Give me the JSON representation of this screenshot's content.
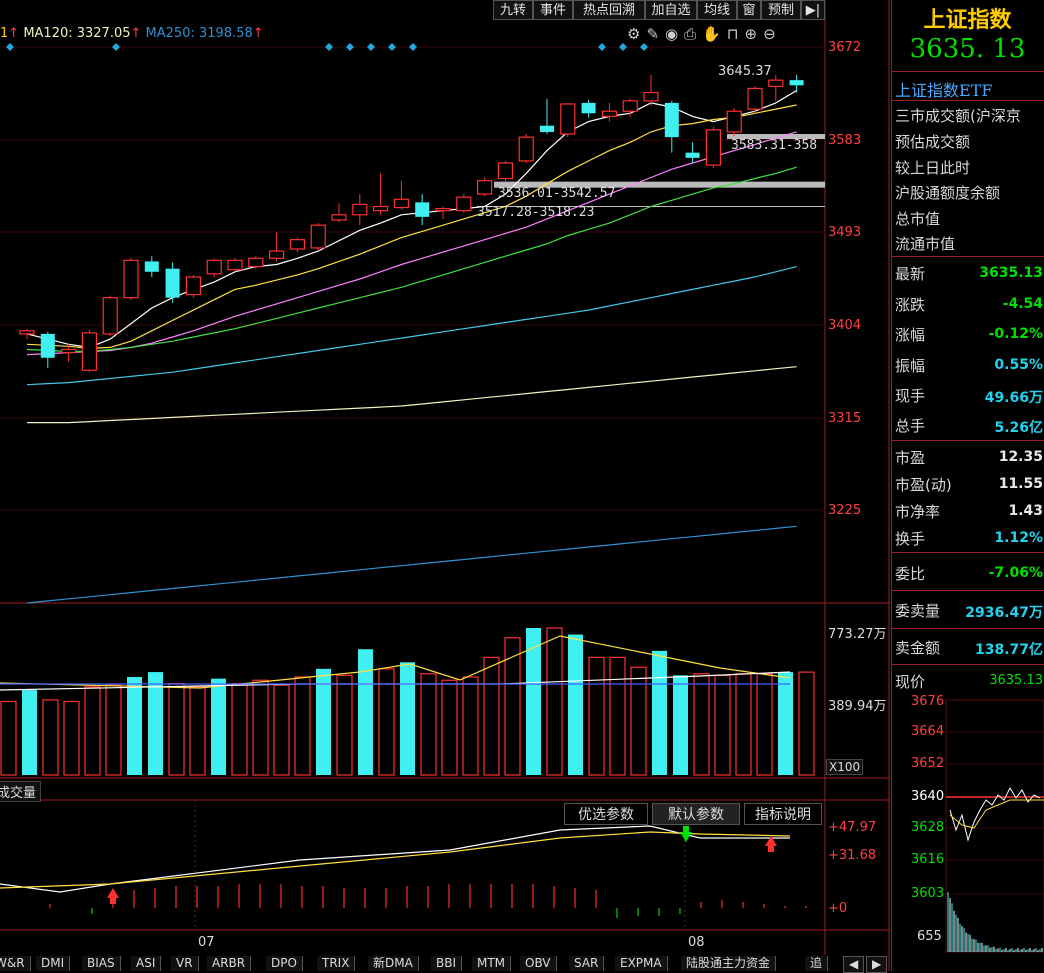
{
  "toolbar": {
    "buttons": [
      "九转",
      "事件",
      "热点回溯",
      "加自选",
      "均线",
      "窗",
      "预制"
    ]
  },
  "ma_legend": {
    "ma120_label": "MA120: 3327.05",
    "ma250_label": "MA250: 3198.58",
    "left_fragment": "1"
  },
  "price_axis": [
    "3672",
    "3583",
    "3493",
    "3404",
    "3315",
    "3225"
  ],
  "annotations": {
    "high": "3645.37",
    "gap1": "3583.31-358",
    "gap2": "3536.01-3542.57",
    "gap3": "3517.28-3518.23"
  },
  "volume_axis": {
    "top": "773.27万",
    "mid": "389.94万",
    "unit": "X100",
    "label": "成交量"
  },
  "macd": {
    "buttons": [
      "优选参数",
      "默认参数",
      "指标说明"
    ],
    "axis": [
      "+47.97",
      "+31.68",
      "+0"
    ]
  },
  "time_axis": [
    "07",
    "08"
  ],
  "indicator_tabs": [
    "W&R",
    "DMI",
    "BIAS",
    "ASI",
    "VR",
    "ARBR",
    "DPO",
    "TRIX",
    "新DMA",
    "BBI",
    "MTM",
    "OBV",
    "SAR",
    "EXPMA",
    "陆股通主力资金",
    "追"
  ],
  "panel": {
    "title": "上证指数",
    "price": "3635. 13",
    "etf": "上证指数ETF",
    "info_rows": [
      "三市成交额(沪深京",
      "预估成交额",
      "较上日此时",
      "沪股通额度余额",
      "总市值",
      "流通市值"
    ],
    "quotes": [
      {
        "label": "最新",
        "value": "3635.13"
      },
      {
        "label": "涨跌",
        "value": "-4.54"
      },
      {
        "label": "涨幅",
        "value": "-0.12%"
      },
      {
        "label": "振幅",
        "value": "0.55%"
      },
      {
        "label": "现手",
        "value": "49.66万"
      },
      {
        "label": "总手",
        "value": "5.26亿"
      }
    ],
    "valuation": [
      {
        "label": "市盈",
        "value": "12.35"
      },
      {
        "label": "市盈(动)",
        "value": "11.55"
      },
      {
        "label": "市净率",
        "value": "1.43"
      },
      {
        "label": "换手",
        "value": "1.12%"
      }
    ],
    "weibi": {
      "label": "委比",
      "value": "-7.06%"
    },
    "weimai": {
      "label": "委卖量",
      "value": "2936.47万"
    },
    "maijin": {
      "label": "卖金额",
      "value": "138.77亿"
    },
    "xianjia": {
      "label": "现价",
      "value": "3635.13"
    },
    "mini_axis": [
      "3676",
      "3664",
      "3652",
      "3640",
      "3628",
      "3616",
      "3603",
      "655"
    ]
  },
  "chart_data": {
    "type": "candlestick",
    "ylim": [
      3180,
      3690
    ],
    "candles": [
      {
        "o": 3398,
        "c": 3395,
        "h": 3400,
        "l": 3390,
        "up": true
      },
      {
        "o": 3395,
        "c": 3372,
        "h": 3397,
        "l": 3362,
        "up": false
      },
      {
        "o": 3377,
        "c": 3380,
        "h": 3385,
        "l": 3368,
        "up": true
      },
      {
        "o": 3360,
        "c": 3396,
        "h": 3399,
        "l": 3358,
        "up": true
      },
      {
        "o": 3395,
        "c": 3430,
        "h": 3432,
        "l": 3393,
        "up": true
      },
      {
        "o": 3430,
        "c": 3466,
        "h": 3468,
        "l": 3428,
        "up": true
      },
      {
        "o": 3465,
        "c": 3455,
        "h": 3470,
        "l": 3450,
        "up": false
      },
      {
        "o": 3458,
        "c": 3430,
        "h": 3464,
        "l": 3425,
        "up": false
      },
      {
        "o": 3433,
        "c": 3450,
        "h": 3452,
        "l": 3430,
        "up": true
      },
      {
        "o": 3453,
        "c": 3466,
        "h": 3468,
        "l": 3450,
        "up": true
      },
      {
        "o": 3457,
        "c": 3466,
        "h": 3468,
        "l": 3455,
        "up": true
      },
      {
        "o": 3460,
        "c": 3468,
        "h": 3470,
        "l": 3458,
        "up": true
      },
      {
        "o": 3468,
        "c": 3475,
        "h": 3493,
        "l": 3465,
        "up": true
      },
      {
        "o": 3477,
        "c": 3486,
        "h": 3488,
        "l": 3474,
        "up": true
      },
      {
        "o": 3478,
        "c": 3500,
        "h": 3502,
        "l": 3476,
        "up": true
      },
      {
        "o": 3505,
        "c": 3510,
        "h": 3521,
        "l": 3503,
        "up": true
      },
      {
        "o": 3510,
        "c": 3520,
        "h": 3530,
        "l": 3500,
        "up": true
      },
      {
        "o": 3514,
        "c": 3518,
        "h": 3550,
        "l": 3510,
        "up": true
      },
      {
        "o": 3517,
        "c": 3525,
        "h": 3543,
        "l": 3515,
        "up": true
      },
      {
        "o": 3522,
        "c": 3508,
        "h": 3530,
        "l": 3500,
        "up": false
      },
      {
        "o": 3514,
        "c": 3516,
        "h": 3518,
        "l": 3506,
        "up": true
      },
      {
        "o": 3514,
        "c": 3527,
        "h": 3530,
        "l": 3512,
        "up": true
      },
      {
        "o": 3530,
        "c": 3543,
        "h": 3546,
        "l": 3528,
        "up": true
      },
      {
        "o": 3545,
        "c": 3560,
        "h": 3562,
        "l": 3542,
        "up": true
      },
      {
        "o": 3562,
        "c": 3585,
        "h": 3588,
        "l": 3560,
        "up": true
      },
      {
        "o": 3596,
        "c": 3590,
        "h": 3622,
        "l": 3588,
        "up": false
      },
      {
        "o": 3588,
        "c": 3617,
        "h": 3618,
        "l": 3585,
        "up": true
      },
      {
        "o": 3618,
        "c": 3608,
        "h": 3621,
        "l": 3604,
        "up": false
      },
      {
        "o": 3605,
        "c": 3610,
        "h": 3618,
        "l": 3600,
        "up": true
      },
      {
        "o": 3610,
        "c": 3620,
        "h": 3622,
        "l": 3605,
        "up": true
      },
      {
        "o": 3620,
        "c": 3628,
        "h": 3645,
        "l": 3615,
        "up": true
      },
      {
        "o": 3618,
        "c": 3585,
        "h": 3620,
        "l": 3570,
        "up": false
      },
      {
        "o": 3570,
        "c": 3565,
        "h": 3580,
        "l": 3560,
        "up": false
      },
      {
        "o": 3558,
        "c": 3592,
        "h": 3595,
        "l": 3555,
        "up": true
      },
      {
        "o": 3590,
        "c": 3610,
        "h": 3613,
        "l": 3586,
        "up": true
      },
      {
        "o": 3612,
        "c": 3632,
        "h": 3634,
        "l": 3608,
        "up": true
      },
      {
        "o": 3634,
        "c": 3640,
        "h": 3645,
        "l": 3620,
        "up": true
      },
      {
        "o": 3640,
        "c": 3635,
        "h": 3645,
        "l": 3628,
        "up": false
      }
    ],
    "ma": [
      {
        "name": "ma5",
        "color": "#ffffff",
        "values": [
          3395,
          3390,
          3385,
          3382,
          3390,
          3405,
          3420,
          3430,
          3438,
          3445,
          3455,
          3460,
          3462,
          3468,
          3475,
          3485,
          3495,
          3502,
          3510,
          3512,
          3514,
          3516,
          3518,
          3530,
          3550,
          3572,
          3590,
          3600,
          3605,
          3608,
          3618,
          3614,
          3605,
          3600,
          3605,
          3610,
          3618,
          3630
        ]
      },
      {
        "name": "ma10",
        "color": "#ffe040",
        "values": [
          3385,
          3384,
          3383,
          3381,
          3382,
          3388,
          3398,
          3408,
          3418,
          3428,
          3438,
          3442,
          3447,
          3452,
          3458,
          3465,
          3472,
          3480,
          3488,
          3494,
          3500,
          3506,
          3512,
          3518,
          3528,
          3540,
          3552,
          3562,
          3572,
          3580,
          3590,
          3596,
          3598,
          3602,
          3604,
          3608,
          3612,
          3616
        ]
      },
      {
        "name": "ma20",
        "color": "#ff80ff",
        "values": [
          3375,
          3376,
          3377,
          3378,
          3379,
          3382,
          3386,
          3392,
          3398,
          3405,
          3412,
          3418,
          3424,
          3430,
          3436,
          3442,
          3448,
          3455,
          3462,
          3468,
          3474,
          3480,
          3486,
          3492,
          3498,
          3506,
          3514,
          3522,
          3530,
          3538,
          3546,
          3554,
          3560,
          3566,
          3572,
          3578,
          3584,
          3590
        ]
      },
      {
        "name": "ma30",
        "color": "#40e040",
        "values": [
          3380,
          3379,
          3378,
          3378,
          3380,
          3382,
          3385,
          3388,
          3392,
          3396,
          3400,
          3405,
          3410,
          3415,
          3420,
          3425,
          3430,
          3435,
          3440,
          3446,
          3452,
          3458,
          3464,
          3470,
          3476,
          3482,
          3490,
          3496,
          3502,
          3510,
          3518,
          3524,
          3530,
          3536,
          3540,
          3545,
          3550,
          3556
        ]
      },
      {
        "name": "ma60",
        "color": "#40c8e8",
        "values": [
          3346,
          3347,
          3348,
          3350,
          3352,
          3354,
          3356,
          3358,
          3361,
          3364,
          3367,
          3370,
          3373,
          3376,
          3379,
          3382,
          3385,
          3388,
          3391,
          3394,
          3397,
          3400,
          3403,
          3406,
          3409,
          3412,
          3415,
          3418,
          3422,
          3426,
          3430,
          3434,
          3438,
          3442,
          3446,
          3450,
          3455,
          3460
        ]
      },
      {
        "name": "ma120",
        "color": "#f0f0c0",
        "values": [
          3348,
          3348,
          3348,
          3349,
          3350,
          3351,
          3352,
          3353,
          3354,
          3355,
          3356,
          3357,
          3358,
          3359,
          3360,
          3361,
          3362,
          3363,
          3364,
          3366,
          3368,
          3370,
          3372,
          3374,
          3376,
          3378,
          3380,
          3382,
          3384,
          3386,
          3388,
          3390,
          3392,
          3394,
          3396,
          3398,
          3400,
          3402
        ]
      },
      {
        "name": "ma250",
        "color": "#3090d0",
        "values": [
          3198,
          3200,
          3202,
          3204,
          3206,
          3208,
          3210,
          3212,
          3214,
          3216,
          3218,
          3220,
          3222,
          3224,
          3226,
          3228,
          3230,
          3232,
          3234,
          3236,
          3238,
          3240,
          3242,
          3244,
          3246,
          3248,
          3250,
          3252,
          3254,
          3256,
          3258,
          3260,
          3262,
          3264,
          3266,
          3268,
          3270,
          3272
        ]
      }
    ],
    "volume": [
      {
        "v": 450,
        "up": true
      },
      {
        "v": 520,
        "up": false
      },
      {
        "v": 460,
        "up": true
      },
      {
        "v": 450,
        "up": true
      },
      {
        "v": 540,
        "up": true
      },
      {
        "v": 550,
        "up": true
      },
      {
        "v": 600,
        "up": false
      },
      {
        "v": 630,
        "up": false
      },
      {
        "v": 560,
        "up": true
      },
      {
        "v": 540,
        "up": true
      },
      {
        "v": 590,
        "up": false
      },
      {
        "v": 560,
        "up": true
      },
      {
        "v": 580,
        "up": true
      },
      {
        "v": 550,
        "up": true
      },
      {
        "v": 600,
        "up": true
      },
      {
        "v": 650,
        "up": false
      },
      {
        "v": 610,
        "up": true
      },
      {
        "v": 770,
        "up": false
      },
      {
        "v": 650,
        "up": true
      },
      {
        "v": 690,
        "up": false
      },
      {
        "v": 620,
        "up": true
      },
      {
        "v": 580,
        "up": true
      },
      {
        "v": 600,
        "up": true
      },
      {
        "v": 720,
        "up": true
      },
      {
        "v": 840,
        "up": true
      },
      {
        "v": 900,
        "up": false
      },
      {
        "v": 900,
        "up": true
      },
      {
        "v": 860,
        "up": false
      },
      {
        "v": 720,
        "up": true
      },
      {
        "v": 720,
        "up": true
      },
      {
        "v": 660,
        "up": true
      },
      {
        "v": 760,
        "up": false
      },
      {
        "v": 610,
        "up": false
      },
      {
        "v": 620,
        "up": true
      },
      {
        "v": 610,
        "up": true
      },
      {
        "v": 620,
        "up": true
      },
      {
        "v": 620,
        "up": true
      },
      {
        "v": 630,
        "up": false
      },
      {
        "v": 630,
        "up": true
      }
    ],
    "macd_hist": [
      0,
      0,
      2,
      0,
      -3,
      8,
      9,
      10,
      11,
      11,
      11,
      12,
      12,
      12,
      11,
      11,
      10,
      10,
      10,
      11,
      11,
      12,
      12,
      12,
      12,
      12,
      11,
      10,
      9,
      -5,
      -4,
      -4,
      -3,
      3,
      4,
      3,
      2,
      1,
      1
    ]
  }
}
